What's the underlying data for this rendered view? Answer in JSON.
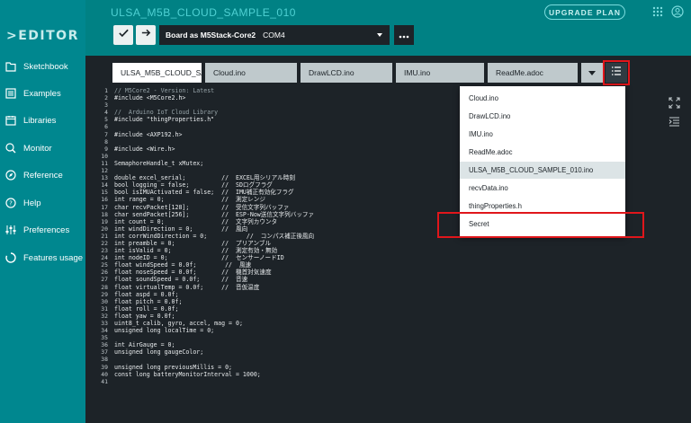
{
  "app": {
    "logo": "EDITOR",
    "sketch_title": "ULSA_M5B_CLOUD_SAMPLE_010",
    "upgrade_label": "UPGRADE PLAN"
  },
  "sidebar": {
    "items": [
      {
        "label": "Sketchbook",
        "icon": "folder-icon"
      },
      {
        "label": "Examples",
        "icon": "examples-icon"
      },
      {
        "label": "Libraries",
        "icon": "libraries-icon"
      },
      {
        "label": "Monitor",
        "icon": "monitor-icon"
      },
      {
        "label": "Reference",
        "icon": "reference-icon"
      },
      {
        "label": "Help",
        "icon": "help-icon"
      },
      {
        "label": "Preferences",
        "icon": "preferences-icon"
      },
      {
        "label": "Features usage",
        "icon": "features-usage-icon"
      }
    ]
  },
  "toolbar": {
    "board_name": "Board as M5Stack-Core2",
    "port": "COM4"
  },
  "tabs": [
    {
      "label": "ULSA_M5B_CLOUD_SAM",
      "active": true
    },
    {
      "label": "Cloud.ino",
      "active": false
    },
    {
      "label": "DrawLCD.ino",
      "active": false
    },
    {
      "label": "IMU.ino",
      "active": false
    },
    {
      "label": "ReadMe.adoc",
      "active": false
    }
  ],
  "menu": {
    "items": [
      {
        "label": "Cloud.ino"
      },
      {
        "label": "DrawLCD.ino"
      },
      {
        "label": "IMU.ino"
      },
      {
        "label": "ReadMe.adoc"
      },
      {
        "label": "ULSA_M5B_CLOUD_SAMPLE_010.ino",
        "selected": true
      },
      {
        "label": "recvData.ino"
      },
      {
        "label": "thingProperties.h"
      },
      {
        "label": "Secret"
      }
    ]
  },
  "editor": {
    "line_numbers": [
      "1",
      "2",
      "3",
      "4",
      "5",
      "6",
      "7",
      "8",
      "9",
      "10",
      "11",
      "12",
      "13",
      "14",
      "15",
      "16",
      "17",
      "18",
      "19",
      "20",
      "21",
      "22",
      "23",
      "24",
      "25",
      "26",
      "27",
      "28",
      "29",
      "30",
      "31",
      "32",
      "33",
      "34",
      "35",
      "36",
      "37",
      "38",
      "39",
      "40",
      "41"
    ],
    "lines": [
      "// M5Core2 - Version: Latest",
      "#include <M5Core2.h>",
      "",
      "//  Arduino IoT Cloud Library",
      "#include \"thingProperties.h\"",
      "",
      "#include <AXP192.h>",
      "",
      "#include <Wire.h>",
      "",
      "SemaphoreHandle_t xMutex;",
      "",
      "double excel_serial;          //  EXCEL用シリアル時刻",
      "bool logging = false;         //  SDログフラグ",
      "bool isIMUActivated = false;  //  IMU補正有効化フラグ",
      "int range = 0;                //  測定レンジ",
      "char recvPacket[128];         //  受信文字列バッファ",
      "char sendPacket[256];         //  ESP-Now送信文字列バッファ",
      "int count = 0;                //  文字列カウンタ",
      "int windDirection = 0;        //  風向",
      "int corrWindDirection = 0;           //  コンパス補正後風向",
      "int preamble = 0;             //  プリアンブル",
      "int isValid = 0;              //  測定有効・無効",
      "int nodeID = 0;               //  センサーノードID",
      "float windSpeed = 0.0f;        //  風速",
      "float noseSpeed = 0.0f;       //  機首対気速度",
      "float soundSpeed = 0.0f;      //  音速",
      "float virtualTemp = 0.0f;     //  音仮温度",
      "float aspd = 0.0f;",
      "float pitch = 0.0f;",
      "float roll = 0.0f;",
      "float yaw = 0.0f;",
      "uint8_t calib, gyro, accel, mag = 0;",
      "unsigned long localTime = 0;",
      "",
      "int AirGauge = 0;",
      "unsigned long gaugeColor;",
      "",
      "unsigned long previousMillis = 0;",
      "const long batteryMonitorInterval = 1000;",
      ""
    ]
  }
}
